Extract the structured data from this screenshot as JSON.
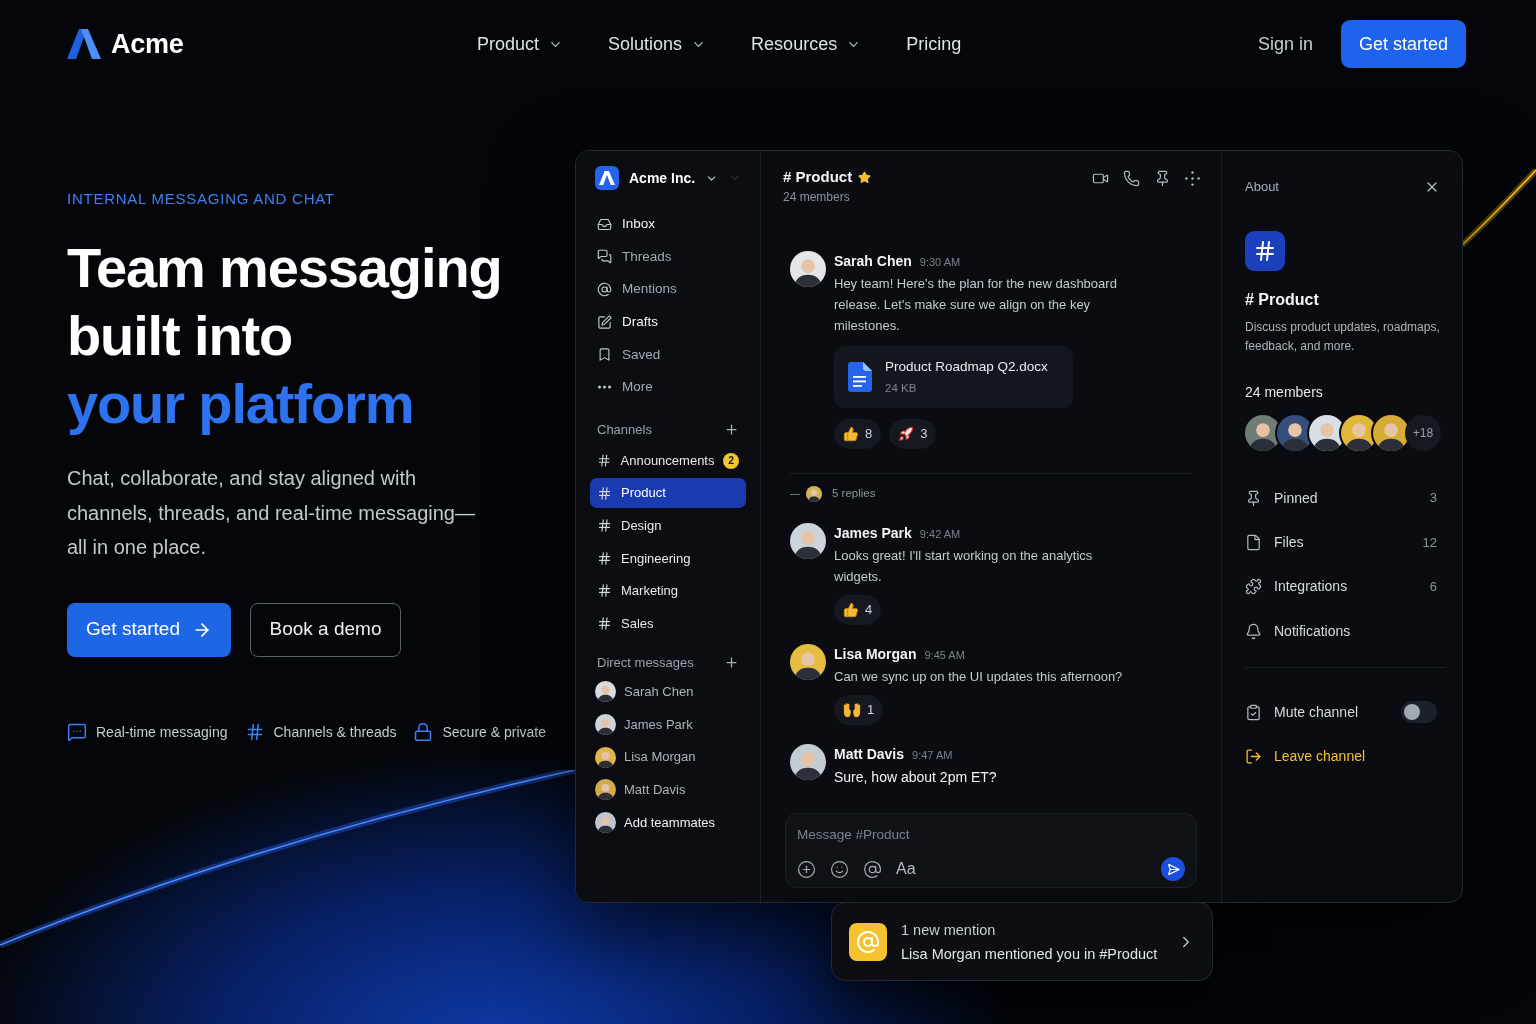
{
  "header": {
    "logo": "Acme",
    "nav": [
      {
        "label": "Product",
        "dropdown": true
      },
      {
        "label": "Solutions",
        "dropdown": true
      },
      {
        "label": "Resources",
        "dropdown": true
      },
      {
        "label": "Pricing",
        "dropdown": false
      }
    ],
    "sign_in": "Sign in",
    "cta": "Get started"
  },
  "hero": {
    "eyebrow": "INTERNAL MESSAGING AND CHAT",
    "headline": [
      {
        "text": "Team messaging",
        "accent": false
      },
      {
        "text": "built into",
        "accent": false
      },
      {
        "text": "your platform",
        "accent": true
      }
    ],
    "description": "Chat, collaborate, and stay aligned with channels, threads, and real-time messaging—all in one place.",
    "buttons": [
      {
        "label": "Get started",
        "kind": "primary"
      },
      {
        "label": "Book a demo",
        "kind": "secondary"
      }
    ],
    "features": [
      {
        "label": "Real-time messaging",
        "kind": "chat"
      },
      {
        "label": "Channels & threads",
        "kind": "hash"
      },
      {
        "label": "Secure & private",
        "kind": "lock"
      }
    ]
  },
  "app": {
    "sidebar": {
      "workspace": "Acme Inc.",
      "nav": [
        {
          "label": "Inbox",
          "kind": "inbox",
          "unread": true
        },
        {
          "label": "Threads",
          "kind": "threads",
          "unread": false
        },
        {
          "label": "Mentions",
          "kind": "mentions",
          "unread": false
        },
        {
          "label": "Drafts",
          "kind": "drafts",
          "unread": true
        },
        {
          "label": "Saved",
          "kind": "saved",
          "unread": false
        },
        {
          "label": "More",
          "kind": "more",
          "unread": false
        }
      ],
      "channels_title": "Channels",
      "channels": [
        {
          "name": "Announcements",
          "selected": false,
          "badge": "2"
        },
        {
          "name": "Product",
          "selected": true
        },
        {
          "name": "Design",
          "selected": false
        },
        {
          "name": "Engineering",
          "selected": false
        },
        {
          "name": "Marketing",
          "selected": false
        },
        {
          "name": "Sales",
          "selected": false
        }
      ],
      "dm_title": "Direct messages",
      "dms": [
        {
          "name": "Sarah Chen",
          "kind": "person",
          "color": "#d9dce1"
        },
        {
          "name": "James Park",
          "kind": "person",
          "color": "#cdd3da"
        },
        {
          "name": "Lisa Morgan",
          "kind": "person",
          "color": "#ddb54a"
        },
        {
          "name": "Matt Davis",
          "kind": "person",
          "color": "#d2ab4c"
        },
        {
          "name": "Add teammates",
          "kind": "invite",
          "color": "#bfc6cf"
        }
      ]
    },
    "chat": {
      "title": "# Product",
      "starred": true,
      "members": "24 members",
      "messages": [
        {
          "author": "Sarah Chen",
          "time": "9:30 AM",
          "color": "#e4e6e9",
          "unread": false,
          "text": "Hey team! Here's the plan for the new dashboard release. Let's make sure we align on the key milestones.",
          "attachment": {
            "name": "Product Roadmap Q2.docx",
            "size": "24 KB"
          },
          "reactions": [
            {
              "kind": "thumbs_up",
              "count": "8"
            },
            {
              "kind": "rocket",
              "count": "3"
            }
          ],
          "replies": "5 replies"
        },
        {
          "author": "James Park",
          "time": "9:42 AM",
          "color": "#ccd3db",
          "unread": false,
          "text": "Looks great! I'll start working on the analytics widgets.",
          "reactions": [
            {
              "kind": "thumbs_up",
              "count": "4"
            }
          ]
        },
        {
          "author": "Lisa Morgan",
          "time": "9:45 AM",
          "color": "#e5bc3f",
          "unread": false,
          "text": "Can we sync up on the UI updates this afternoon?",
          "reactions": [
            {
              "kind": "raised_hands",
              "count": "1"
            }
          ]
        },
        {
          "author": "Matt Davis",
          "time": "9:47 AM",
          "color": "#c4cbd3",
          "unread": true,
          "text": "Sure, how about 2pm ET?"
        }
      ],
      "composer": {
        "placeholder": "Message #Product",
        "format": "Aa"
      }
    },
    "details": {
      "title": "About",
      "channel": "# Product",
      "description": "Discuss product updates, roadmaps, feedback, and more.",
      "members_label": "24 members",
      "members": [
        {
          "color": "#6f7d77"
        },
        {
          "color": "#34507a"
        },
        {
          "color": "#d8dee5"
        },
        {
          "color": "#e2b63b"
        },
        {
          "color": "#d6ab36"
        }
      ],
      "more_members": "+18",
      "rows": [
        {
          "label": "Pinned",
          "kind": "pin",
          "count": "3"
        },
        {
          "label": "Files",
          "kind": "file",
          "count": "12"
        },
        {
          "label": "Integrations",
          "kind": "integrations",
          "count": "6"
        },
        {
          "label": "Notifications",
          "kind": "bell"
        }
      ],
      "mute": {
        "label": "Mute channel",
        "on": false
      },
      "leave": {
        "label": "Leave channel"
      }
    }
  },
  "toast": {
    "title": "1 new mention",
    "text": "Lisa Morgan mentioned you in #Product"
  }
}
